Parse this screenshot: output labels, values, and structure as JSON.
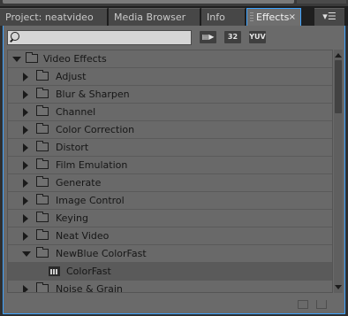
{
  "tabs": [
    {
      "label": "Project: neatvideo"
    },
    {
      "label": "Media Browser"
    },
    {
      "label": "Info"
    },
    {
      "label": "Effects",
      "close": "×"
    }
  ],
  "search": {
    "value": "",
    "placeholder": ""
  },
  "filters": [
    {
      "label": "",
      "icon": "accelerated-effects-icon"
    },
    {
      "label": "32",
      "icon": "32bit-effects-icon"
    },
    {
      "label": "YUV",
      "icon": "yuv-effects-icon"
    }
  ],
  "tree": [
    {
      "label": "Video Effects",
      "level": 0,
      "expanded": true,
      "type": "folder"
    },
    {
      "label": "Adjust",
      "level": 1,
      "expanded": false,
      "type": "folder"
    },
    {
      "label": "Blur & Sharpen",
      "level": 1,
      "expanded": false,
      "type": "folder"
    },
    {
      "label": "Channel",
      "level": 1,
      "expanded": false,
      "type": "folder"
    },
    {
      "label": "Color Correction",
      "level": 1,
      "expanded": false,
      "type": "folder"
    },
    {
      "label": "Distort",
      "level": 1,
      "expanded": false,
      "type": "folder"
    },
    {
      "label": "Film Emulation",
      "level": 1,
      "expanded": false,
      "type": "folder"
    },
    {
      "label": "Generate",
      "level": 1,
      "expanded": false,
      "type": "folder"
    },
    {
      "label": "Image Control",
      "level": 1,
      "expanded": false,
      "type": "folder"
    },
    {
      "label": "Keying",
      "level": 1,
      "expanded": false,
      "type": "folder"
    },
    {
      "label": "Neat Video",
      "level": 1,
      "expanded": false,
      "type": "folder"
    },
    {
      "label": "NewBlue ColorFast",
      "level": 1,
      "expanded": true,
      "type": "folder"
    },
    {
      "label": "ColorFast",
      "level": 2,
      "type": "effect",
      "selected": true
    },
    {
      "label": "Noise & Grain",
      "level": 1,
      "expanded": false,
      "type": "folder"
    }
  ]
}
